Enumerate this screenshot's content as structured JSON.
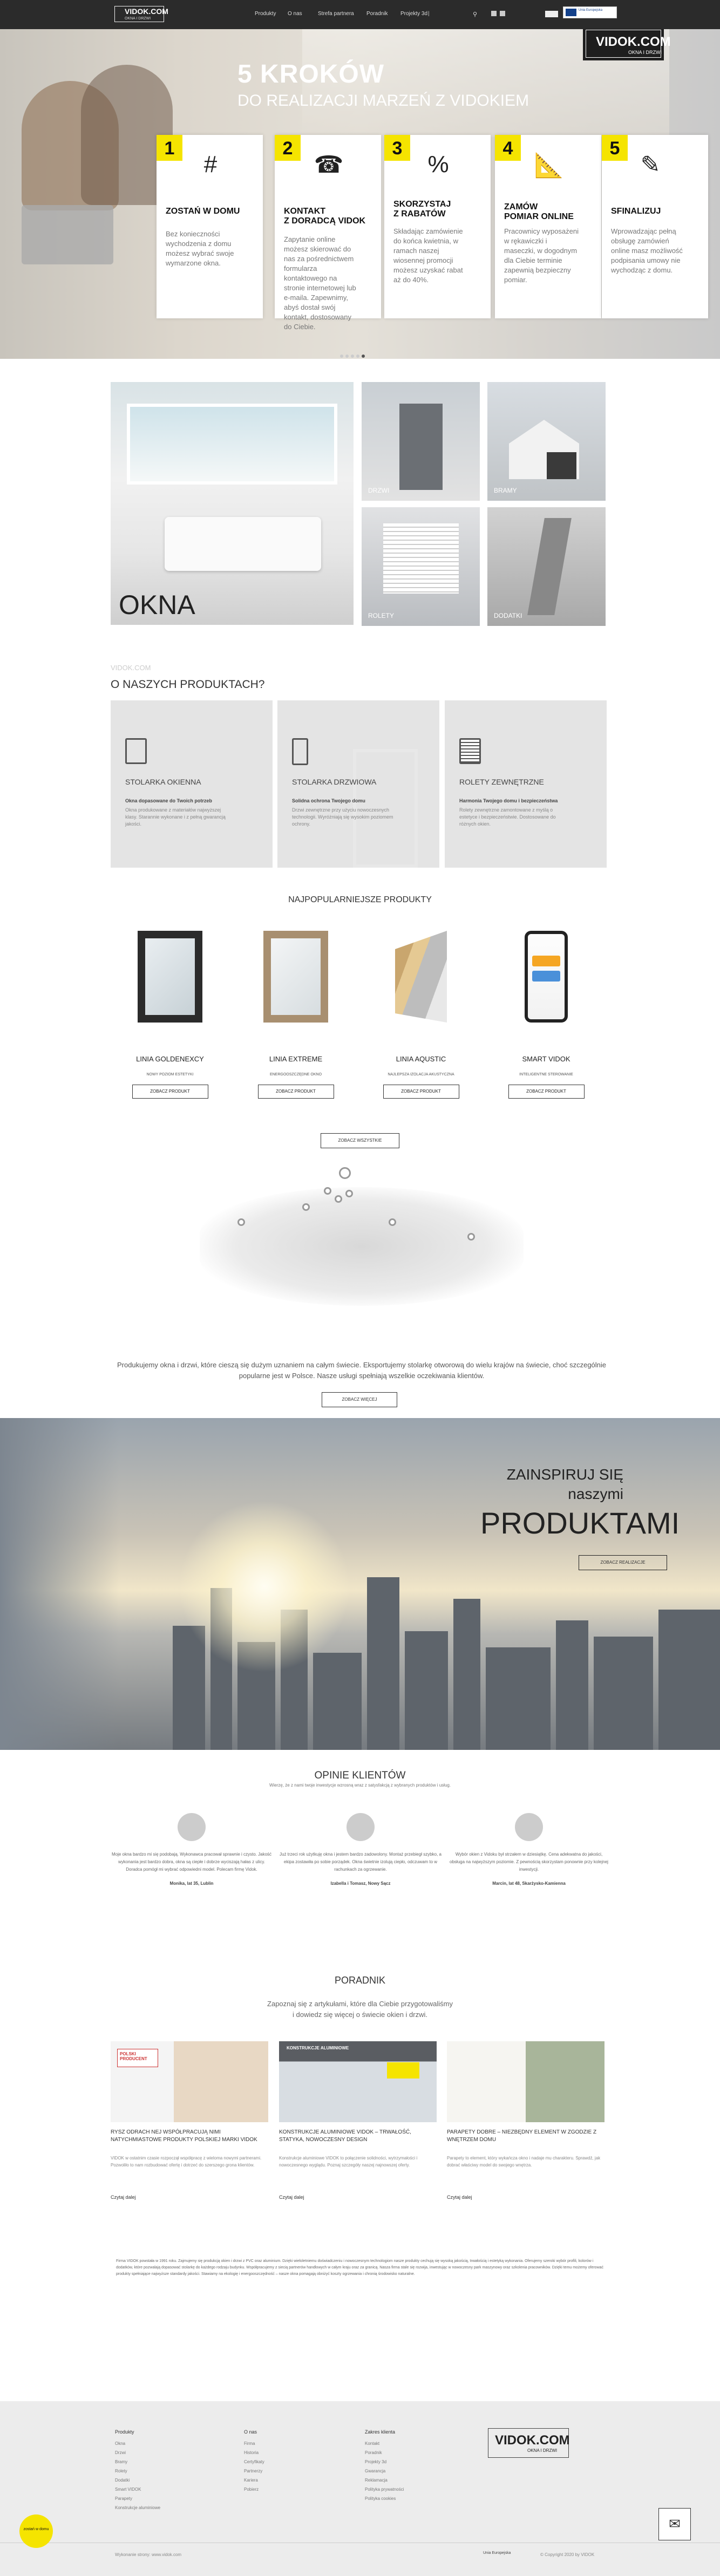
{
  "nav": {
    "logo": "VIDOK.COM",
    "logo_sub": "OKNA I DRZWI",
    "links": [
      "Produkty",
      "O nas",
      "Strefa partnera",
      "Poradnik",
      "Projekty 3d"
    ],
    "ue": "Unia Europejska"
  },
  "hero": {
    "title": "5 KROKÓW",
    "subtitle": "DO REALIZACJI MARZEŃ Z VIDOKIEM",
    "brand": "VIDOK.COM",
    "brand_sub": "OKNA I DRZWI",
    "steps": [
      {
        "num": "1",
        "title_l1": "ZOSTAŃ W DOMU",
        "title_l2": "",
        "text": "Bez konieczności wychodzenia z domu możesz wybrać swoje wymarzone okna.",
        "icon": "#"
      },
      {
        "num": "2",
        "title_l1": "KONTAKT",
        "title_l2": "Z DORADCĄ VIDOK",
        "text": "Zapytanie online możesz skierować do nas za pośrednictwem formularza kontaktowego na stronie internetowej lub e-maila. Zapewnimy, abyś dostał swój kontakt, dostosowany do Ciebie.",
        "icon": "☎"
      },
      {
        "num": "3",
        "title_l1": "SKORZYSTAJ",
        "title_l2": "Z RABATÓW",
        "text": "Składając zamówienie do końca kwietnia, w ramach naszej wiosennej promocji możesz uzyskać rabat aż do 40%.",
        "icon": "%"
      },
      {
        "num": "4",
        "title_l1": "ZAMÓW",
        "title_l2": "POMIAR ONLINE",
        "text": "Pracownicy wyposażeni w rękawiczki i maseczki, w dogodnym dla Ciebie terminie zapewnią bezpieczny pomiar.",
        "icon": "📐"
      },
      {
        "num": "5",
        "title_l1": "SFINALIZUJ",
        "title_l2": "",
        "text": "Wprowadzając pełną obsługę zamówień online masz możliwość podpisania umowy nie wychodząc z domu.",
        "icon": "✎"
      }
    ]
  },
  "categories": {
    "okna": "OKNA",
    "drzwi": "DRZWI",
    "bramy": "BRAMY",
    "rolety": "ROLETY",
    "dodatki": "DODATKI"
  },
  "about": {
    "small": "VIDOK.COM",
    "title": "O NASZYCH PRODUKTACH?",
    "items": [
      {
        "title": "STOLARKA OKIENNA",
        "bold": "Okna dopasowane do Twoich potrzeb",
        "text": "Okna produkowane z materiałów najwyższej klasy. Starannie wykonane i z pełną gwarancją jakości."
      },
      {
        "title": "STOLARKA DRZWIOWA",
        "bold": "Solidna ochrona Twojego domu",
        "text": "Drzwi zewnętrzne przy użyciu nowoczesnych technologii. Wyróżniają się wysokim poziomem ochrony."
      },
      {
        "title": "ROLETY ZEWNĘTRZNE",
        "bold": "Harmonia Twojego domu i bezpieczeństwa",
        "text": "Rolety zewnętrzne zamontowane z myślą o estetyce i bezpieczeństwie. Dostosowane do różnych okien."
      }
    ]
  },
  "popular": {
    "title": "NAJPOPULARNIEJSZE PRODUKTY",
    "items": [
      {
        "name": "LINIA GOLDENEXCY",
        "desc": "NOWY POZIOM ESTETYKI",
        "btn": "ZOBACZ PRODUKT"
      },
      {
        "name": "LINIA EXTREME",
        "desc": "ENERGOOSZCZĘDNE OKNO",
        "btn": "ZOBACZ PRODUKT"
      },
      {
        "name": "LINIA AQUSTIC",
        "desc": "NAJLEPSZA IZOLACJA AKUSTYCZNA",
        "btn": "ZOBACZ PRODUKT"
      },
      {
        "name": "SMART VIDOK",
        "desc": "INTELIGENTNE STEROWANIE",
        "btn": "ZOBACZ PRODUKT"
      }
    ],
    "show_all": "ZOBACZ WSZYSTKIE"
  },
  "map": {
    "text": "Produkujemy okna i drzwi, które cieszą się dużym uznaniem na całym świecie. Eksportujemy stolarkę otworową do wielu krajów na świecie, choć szczególnie popularne jest w Polsce. Nasze usługi spełniają wszelkie oczekiwania klientów.",
    "btn": "ZOBACZ WIĘCEJ"
  },
  "inspire": {
    "line1": "ZAINSPIRUJ SIĘ",
    "line2": "naszymi",
    "line3": "PRODUKTAMI",
    "btn": "ZOBACZ REALIZACJE"
  },
  "reviews": {
    "title": "OPINIE KLIENTÓW",
    "subtitle": "Wierzę, że z nami twoje inwestycje wzrosną wraz z satysfakcją z wybranych produktów i usług.",
    "items": [
      {
        "text": "Moje okna bardzo mi się podobają. Wykonawca pracował sprawnie i czysto. Jakość wykonania jest bardzo dobra, okna są ciepłe i dobrze wyciszają hałas z ulicy. Doradca pomógł mi wybrać odpowiedni model. Polecam firmę Vidok.",
        "author": "Monika, lat 35, Lublin"
      },
      {
        "text": "Już trzeci rok użytkuję okna i jestem bardzo zadowolony. Montaż przebiegł szybko, a ekipa zostawiła po sobie porządek. Okna świetnie izolują ciepło, odczuwam to w rachunkach za ogrzewanie.",
        "author": "Izabella i Tomasz, Nowy Sącz"
      },
      {
        "text": "Wybór okien z Vidoku był strzałem w dziesiątkę. Cena adekwatna do jakości, obsługa na najwyższym poziomie. Z pewnością skorzystam ponownie przy kolejnej inwestycji.",
        "author": "Marcin, lat 48, Skarżysko-Kamienna"
      }
    ]
  },
  "guide": {
    "title": "PORADNIK",
    "subtitle_l1": "Zapoznaj się z artykułami, które dla Ciebie przygotowaliśmy",
    "subtitle_l2": "i dowiedz się więcej o świecie okien i drzwi.",
    "items": [
      {
        "title": "RYSZ ODRACH NEJ WSPÓŁPRACUJĄ NIMI NATYCHMIASTOWE PRODUKTY POLSKIEJ MARKI VIDOK",
        "text": "VIDOK w ostatnim czasie rozpoczął współpracę z wieloma nowymi partnerami. Pozwoliło to nam rozbudować ofertę i dotrzeć do szerszego grona klientów.",
        "link": "Czytaj dalej",
        "badge": "POLSKI PRODUCENT"
      },
      {
        "title": "KONSTRUKCJE ALUMINIOWE VIDOK – TRWAŁOŚĆ, STATYKA, NOWOCZESNY DESIGN",
        "text": "Konstrukcje aluminiowe VIDOK to połączenie solidności, wytrzymałości i nowoczesnego wyglądu. Poznaj szczegóły naszej najnowszej oferty.",
        "link": "Czytaj dalej",
        "badge": "KONSTRUKCJE ALUMINIOWE"
      },
      {
        "title": "PARAPETY DOBRE – NIEZBĘDNY ELEMENT W ZGODZIE Z WNĘTRZEM DOMU",
        "text": "Parapety to element, który wykańcza okno i nadaje mu charakteru. Sprawdź, jak dobrać właściwy model do swojego wnętrza.",
        "link": "Czytaj dalej",
        "badge": ""
      }
    ]
  },
  "legal": "Firma VIDOK powstała w 1991 roku. Zajmujemy się produkcją okien i drzwi z PVC oraz aluminium. Dzięki wieloletniemu doświadczeniu i nowoczesnym technologiom nasze produkty cechują się wysoką jakością, trwałością i estetyką wykonania. Oferujemy szeroki wybór profili, kolorów i dodatków, które pozwalają dopasować stolarkę do każdego rodzaju budynku. Współpracujemy z siecią partnerów handlowych w całym kraju oraz za granicą. Nasza firma stale się rozwija, inwestując w nowoczesny park maszynowy oraz szkolenia pracowników. Dzięki temu możemy oferować produkty spełniające najwyższe standardy jakości. Stawiamy na ekologię i energooszczędność – nasze okna pomagają obniżyć koszty ogrzewania i chronią środowisko naturalne.",
  "footer": {
    "cols": [
      {
        "title": "Produkty",
        "links": [
          "Okna",
          "Drzwi",
          "Bramy",
          "Rolety",
          "Dodatki",
          "Smart VIDOK",
          "Parapety",
          "Konstrukcje aluminiowe"
        ]
      },
      {
        "title": "O nas",
        "links": [
          "Firma",
          "Historia",
          "Certyfikaty",
          "Partnerzy",
          "Kariera",
          "Pobierz"
        ]
      },
      {
        "title": "Zakres klienta",
        "links": [
          "Kontakt",
          "Poradnik",
          "Projekty 3d",
          "Gwarancja",
          "Reklamacja",
          "Polityka prywatności",
          "Polityka cookies"
        ]
      }
    ],
    "logo": "VIDOK.COM",
    "logo_sub": "OKNA I DRZWI",
    "copy": "Wykonanie strony: www.vidok.com",
    "ue": "Unia Europejska",
    "right": "© Copyright 2020 by VIDOK",
    "badge": "zostań w domu"
  }
}
